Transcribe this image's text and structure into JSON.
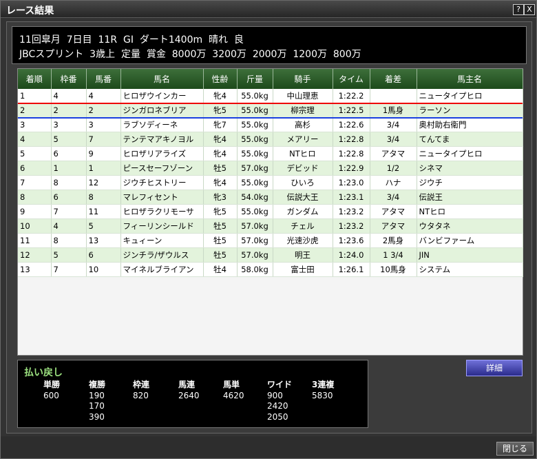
{
  "window": {
    "title": "レース結果",
    "help_label": "?",
    "close_x_label": "X"
  },
  "race": {
    "line1": "11回皐月  7日目  11R  GⅠ  ダート1400m  晴れ  良",
    "line2": "JBCスプリント  3歳上  定量  賞金  8000万  3200万  2000万  1200万  800万"
  },
  "table": {
    "headers": [
      "着順",
      "枠番",
      "馬番",
      "馬名",
      "性齢",
      "斤量",
      "騎手",
      "タイム",
      "着差",
      "馬主名"
    ],
    "rows": [
      [
        "1",
        "4",
        "4",
        "ヒロザウインカー",
        "牝4",
        "55.0kg",
        "中山理恵",
        "1:22.2",
        "",
        "ニュータイプヒロ"
      ],
      [
        "2",
        "2",
        "2",
        "ジンガロネブリア",
        "牝5",
        "55.0kg",
        "柳宗理",
        "1:22.5",
        "1馬身",
        "ラーソン"
      ],
      [
        "3",
        "3",
        "3",
        "ラブソディーネ",
        "牝7",
        "55.0kg",
        "高杉",
        "1:22.6",
        "3/4",
        "奥村助右衛門"
      ],
      [
        "4",
        "5",
        "7",
        "テンテマアキノヨル",
        "牝4",
        "55.0kg",
        "メアリー",
        "1:22.8",
        "3/4",
        "てんてま"
      ],
      [
        "5",
        "6",
        "9",
        "ヒロザリアライズ",
        "牝4",
        "55.0kg",
        "NTヒロ",
        "1:22.8",
        "アタマ",
        "ニュータイプヒロ"
      ],
      [
        "6",
        "1",
        "1",
        "ピースセーフゾーン",
        "牡5",
        "57.0kg",
        "デビッド",
        "1:22.9",
        "1/2",
        "シネマ"
      ],
      [
        "7",
        "8",
        "12",
        "ジウチヒストリー",
        "牝4",
        "55.0kg",
        "ひいろ",
        "1:23.0",
        "ハナ",
        "ジウチ"
      ],
      [
        "8",
        "6",
        "8",
        "マレフィセント",
        "牝3",
        "54.0kg",
        "伝説大王",
        "1:23.1",
        "3/4",
        "伝説王"
      ],
      [
        "9",
        "7",
        "11",
        "ヒロザラクリモーサ",
        "牝5",
        "55.0kg",
        "ガンダム",
        "1:23.2",
        "アタマ",
        "NTヒロ"
      ],
      [
        "10",
        "4",
        "5",
        "フィーリンシールド",
        "牡5",
        "57.0kg",
        "チェル",
        "1:23.2",
        "アタマ",
        "ウタタネ"
      ],
      [
        "11",
        "8",
        "13",
        "キュィーン",
        "牡5",
        "57.0kg",
        "光速沙虎",
        "1:23.6",
        "2馬身",
        "バンビファーム"
      ],
      [
        "12",
        "5",
        "6",
        "ジンチラ/ザウルス",
        "牡5",
        "57.0kg",
        "明王",
        "1:24.0",
        "1 3/4",
        "JIN"
      ],
      [
        "13",
        "7",
        "10",
        "マイネルブライアン",
        "牡4",
        "58.0kg",
        "富士田",
        "1:26.1",
        "10馬身",
        "システム"
      ]
    ]
  },
  "payout": {
    "title": "払い戻し",
    "columns": [
      {
        "header": "単勝",
        "values": [
          "600"
        ]
      },
      {
        "header": "複勝",
        "values": [
          "190",
          "170",
          "390"
        ]
      },
      {
        "header": "枠連",
        "values": [
          "820"
        ]
      },
      {
        "header": "馬連",
        "values": [
          "2640"
        ]
      },
      {
        "header": "馬単",
        "values": [
          "4620"
        ]
      },
      {
        "header": "ワイド",
        "values": [
          "900",
          "2420",
          "2050"
        ]
      },
      {
        "header": "3連複",
        "values": [
          "5830"
        ]
      }
    ]
  },
  "buttons": {
    "detail": "詳細",
    "close": "閉じる"
  },
  "colors": {
    "header_green": "#2b5a28",
    "row_alt": "#e3f3dc",
    "highlight_red": "#e00000",
    "highlight_blue": "#1a3fe0",
    "payout_title": "#9be07f"
  }
}
